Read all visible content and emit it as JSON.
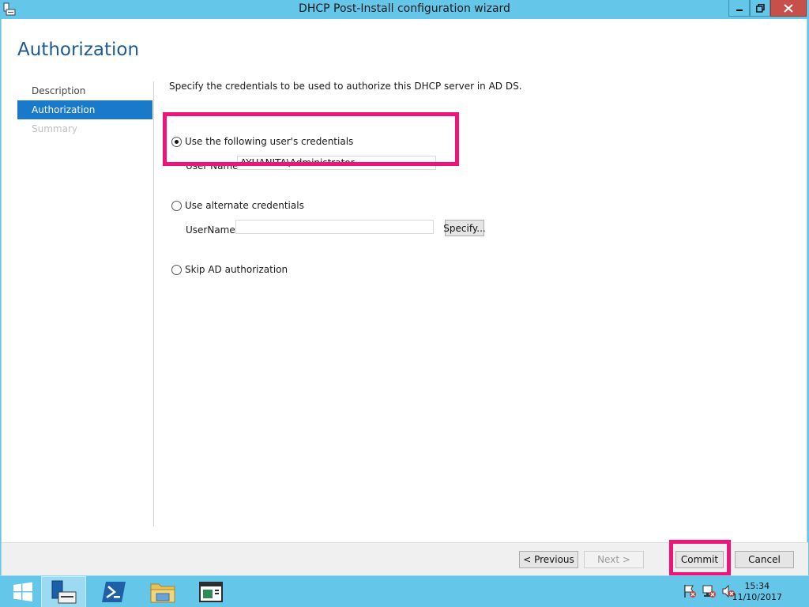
{
  "window": {
    "title": "DHCP Post-Install configuration wizard",
    "page_title": "Authorization"
  },
  "nav": {
    "items": [
      {
        "label": "Description",
        "state": "normal"
      },
      {
        "label": "Authorization",
        "state": "active"
      },
      {
        "label": "Summary",
        "state": "disabled"
      }
    ]
  },
  "content": {
    "description": "Specify the credentials to be used to authorize this DHCP server in AD DS.",
    "option_current": {
      "label": "Use the following user's credentials",
      "selected": true,
      "field_label": "User Name:",
      "field_value": "AYUANITA\\Administrator"
    },
    "option_alternate": {
      "label": "Use alternate credentials",
      "selected": false,
      "field_label": "UserName:",
      "field_value": "",
      "specify_button": "Specify..."
    },
    "option_skip": {
      "label": "Skip AD authorization",
      "selected": false
    }
  },
  "footer": {
    "previous": "< Previous",
    "next": "Next >",
    "commit": "Commit",
    "cancel": "Cancel"
  },
  "taskbar": {
    "time": "15:34",
    "date": "11/10/2017",
    "items": [
      "start-icon",
      "server-manager-icon",
      "powershell-icon",
      "file-explorer-icon",
      "app-window-icon"
    ]
  },
  "colors": {
    "accent": "#1979ca",
    "title_color": "#1e5b8c",
    "highlight": "#f0147a",
    "chrome": "#64c7ea"
  }
}
